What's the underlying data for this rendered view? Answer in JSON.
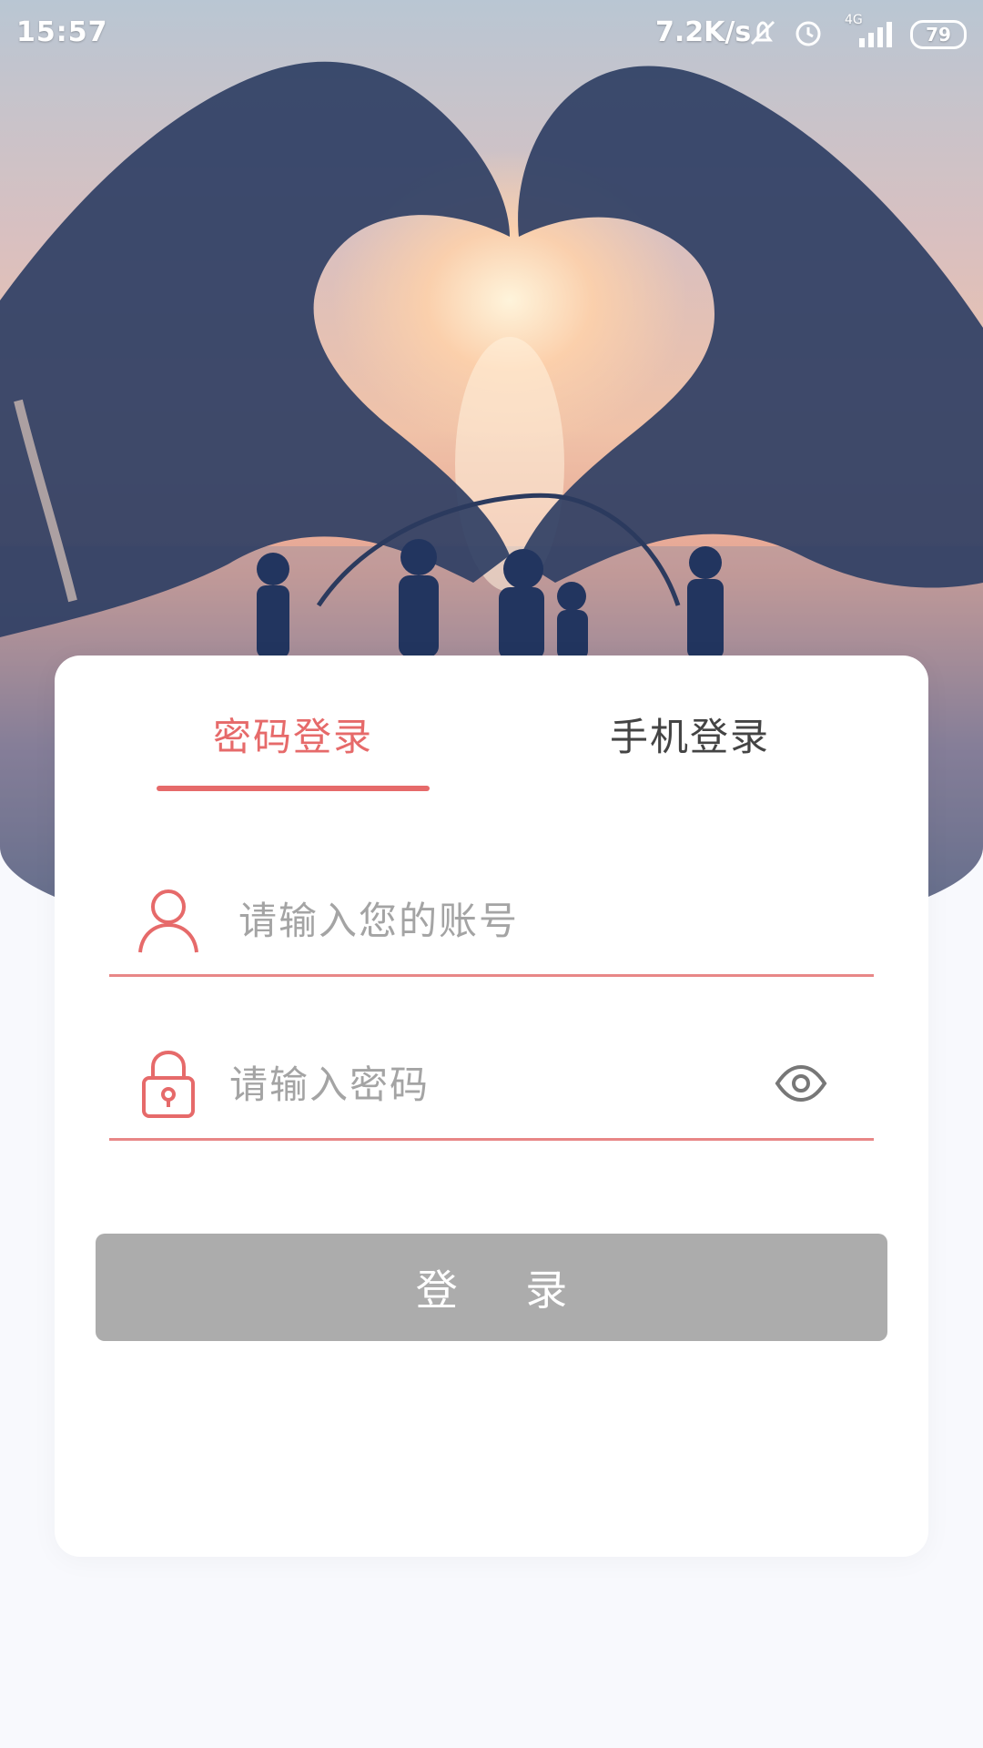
{
  "status_bar": {
    "time": "15:57",
    "net_speed": "7.2K/s",
    "network": "4G",
    "battery": "79",
    "icons": [
      "mute-bell-icon",
      "alarm-icon",
      "signal-icon",
      "battery-icon"
    ]
  },
  "tabs": [
    {
      "label": "密码登录",
      "active": true
    },
    {
      "label": "手机登录",
      "active": false
    }
  ],
  "form": {
    "account_placeholder": "请输入您的账号",
    "account_value": "",
    "password_placeholder": "请输入密码",
    "password_value": "",
    "login_label": "登 录"
  },
  "colors": {
    "accent": "#e66a6a",
    "button_disabled": "#acacac",
    "page_bg": "#f8f9fd"
  }
}
